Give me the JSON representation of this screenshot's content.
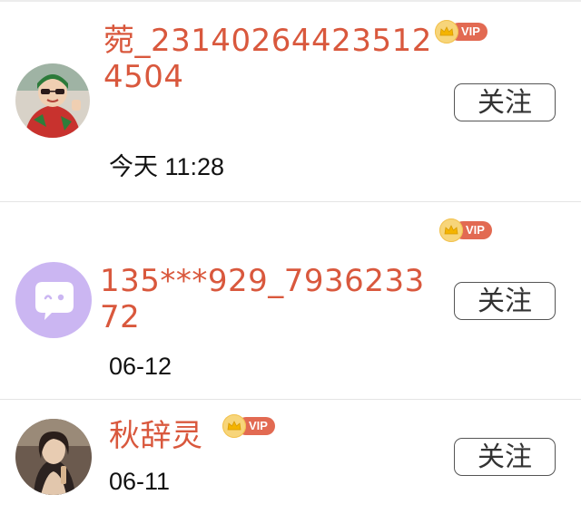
{
  "follow_label": "关注",
  "vip_label": "VIP",
  "users": [
    {
      "name": "菀_231402644235124504",
      "time": "今天 11:28",
      "avatar": "person-in-red-outfit-with-sunglasses"
    },
    {
      "name": "135***929_793623372",
      "time": "06-12",
      "avatar": "default-chat-bubble-avatar"
    },
    {
      "name": "秋辞灵",
      "time": "06-11",
      "avatar": "woman-photo"
    }
  ],
  "colors": {
    "name": "#d9583d",
    "vip_pill": "#e26a52",
    "vip_crown": "#f7d57a",
    "default_avatar": "#cbb6f2"
  }
}
